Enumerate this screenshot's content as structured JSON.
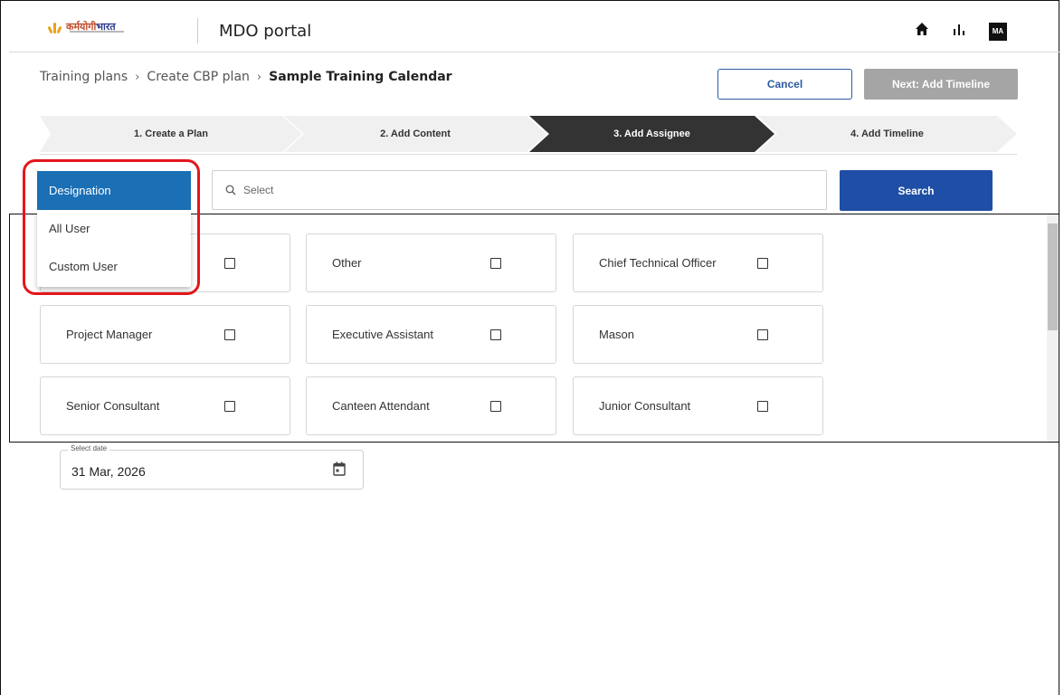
{
  "header": {
    "logo_text_hindi": "कर्मयोगी",
    "logo_text_hindi_2": "भारत",
    "app_title": "MDO portal",
    "avatar_initials": "MA",
    "icons": [
      "home-icon",
      "bar-chart-icon"
    ]
  },
  "breadcrumb": {
    "items": [
      "Training plans",
      "Create CBP plan",
      "Sample Training Calendar"
    ],
    "separator": "›"
  },
  "actions": {
    "cancel_label": "Cancel",
    "next_label": "Next: Add Timeline"
  },
  "stepper": {
    "steps": [
      {
        "label": "1. Create a Plan",
        "active": false
      },
      {
        "label": "2. Add Content",
        "active": false
      },
      {
        "label": "3. Add Assignee",
        "active": true
      },
      {
        "label": "4. Add Timeline",
        "active": false
      }
    ]
  },
  "filter": {
    "dropdown_label": "Designation",
    "search_placeholder": "Select",
    "search_button": "Search",
    "menu_options": [
      "All User",
      "Custom User"
    ]
  },
  "designations": [
    {
      "label": "",
      "checked": false
    },
    {
      "label": "Other",
      "checked": false
    },
    {
      "label": "Chief Technical Officer",
      "checked": false
    },
    {
      "label": "Project Manager",
      "checked": false
    },
    {
      "label": "Executive Assistant",
      "checked": false
    },
    {
      "label": "Mason",
      "checked": false
    },
    {
      "label": "Senior Consultant",
      "checked": false
    },
    {
      "label": "Canteen Attendant",
      "checked": false
    },
    {
      "label": "Junior Consultant",
      "checked": false
    }
  ],
  "date": {
    "legend": "Select date",
    "value": "31 Mar, 2026"
  },
  "colors": {
    "designation_bg": "#1b6fb5",
    "search_button_bg": "#1e4ea5",
    "active_step_bg": "#333333",
    "highlight": "#e4161c",
    "disabled_button": "#a5a5a5"
  }
}
